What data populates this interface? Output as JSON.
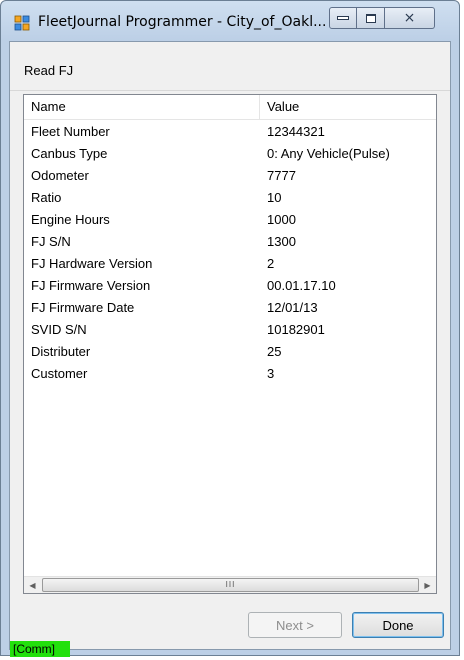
{
  "window": {
    "title": "FleetJournal Programmer - City_of_Oakl...",
    "close_glyph": "⨯"
  },
  "header": {
    "title": "Read FJ"
  },
  "list": {
    "columns": [
      "Name",
      "Value"
    ],
    "rows": [
      {
        "name": "Fleet Number",
        "value": "12344321"
      },
      {
        "name": "Canbus Type",
        "value": "0: Any Vehicle(Pulse)"
      },
      {
        "name": "Odometer",
        "value": "7777"
      },
      {
        "name": "Ratio",
        "value": "10"
      },
      {
        "name": "Engine Hours",
        "value": "1000"
      },
      {
        "name": "FJ S/N",
        "value": "1300"
      },
      {
        "name": "FJ Hardware Version",
        "value": "2"
      },
      {
        "name": "FJ Firmware Version",
        "value": "00.01.17.10"
      },
      {
        "name": "FJ Firmware Date",
        "value": "12/01/13"
      },
      {
        "name": "SVID S/N",
        "value": "10182901"
      },
      {
        "name": "Distributer",
        "value": "25"
      },
      {
        "name": "Customer",
        "value": "3"
      }
    ],
    "scroll_grip": "III"
  },
  "buttons": {
    "next": "Next >",
    "done": "Done"
  },
  "status": {
    "comm": "[Comm]",
    "comm_color": "#22e00c"
  }
}
